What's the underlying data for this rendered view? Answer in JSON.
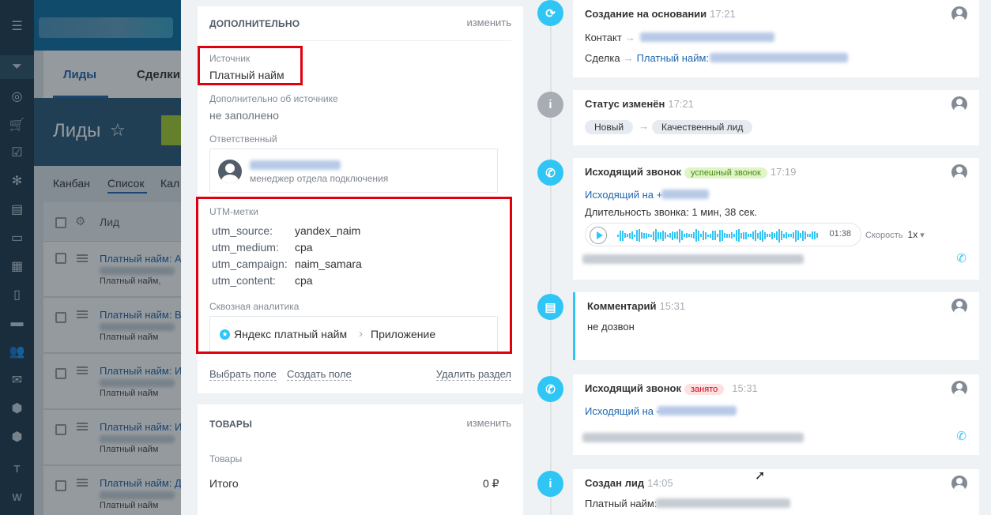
{
  "nav": {
    "letters": [
      "T",
      "W"
    ]
  },
  "background": {
    "tabs": [
      "Лиды",
      "Сделки"
    ],
    "page_title": "Лиды",
    "views": [
      "Канбан",
      "Список",
      "Кал"
    ],
    "column_header": "Лид",
    "rows": [
      {
        "title": "Платный найм: А",
        "sub": "Платный найм,"
      },
      {
        "title": "Платный найм: В",
        "sub": "Платный найм"
      },
      {
        "title": "Платный найм: И",
        "sub": "Платный найм"
      },
      {
        "title": "Платный найм: И",
        "sub": "Платный найм"
      },
      {
        "title": "Платный найм: Д",
        "sub": "Платный найм"
      }
    ]
  },
  "extra_section": {
    "title": "ДОПОЛНИТЕЛЬНО",
    "edit": "изменить",
    "source_label": "Источник",
    "source_value": "Платный найм",
    "source_more_label": "Дополнительно об источнике",
    "source_more_value": "не заполнено",
    "responsible_label": "Ответственный",
    "responsible_role": "менеджер отдела подключения",
    "utm_label": "UTM-метки",
    "utm": [
      {
        "key": "utm_source:",
        "value": "yandex_naim"
      },
      {
        "key": "utm_medium:",
        "value": "cpa"
      },
      {
        "key": "utm_campaign:",
        "value": "naim_samara"
      },
      {
        "key": "utm_content:",
        "value": "cpa"
      }
    ],
    "analytics_label": "Сквозная аналитика",
    "analytics_source": "Яндекс платный найм",
    "analytics_sep": "›",
    "analytics_target": "Приложение",
    "link_choose": "Выбрать поле",
    "link_create": "Создать поле",
    "link_delete": "Удалить раздел"
  },
  "goods_section": {
    "title": "ТОВАРЫ",
    "edit": "изменить",
    "goods_label": "Товары",
    "total_label": "Итого",
    "total_value": "0 ₽"
  },
  "timeline": [
    {
      "title": "Создание на основании",
      "time": "17:21",
      "contact_label": "Контакт",
      "deal_label": "Сделка",
      "deal_link": "Платный найм:"
    },
    {
      "title": "Статус изменён",
      "time": "17:21",
      "from": "Новый",
      "to": "Качественный лид"
    },
    {
      "title": "Исходящий звонок",
      "badge": "успешный звонок",
      "time": "17:19",
      "line1": "Исходящий на +",
      "line2": "Длительность звонка: 1 мин, 38 сек.",
      "duration": "01:38",
      "speed_label": "Скорость",
      "speed_value": "1x"
    },
    {
      "title": "Комментарий",
      "time": "15:31",
      "text": "не дозвон"
    },
    {
      "title": "Исходящий звонок",
      "badge": "занято",
      "time": "15:31",
      "line1": "Исходящий на -"
    },
    {
      "title": "Создан лид",
      "time": "14:05",
      "line1": "Платный найм:"
    }
  ],
  "colors": {
    "accent": "#2fc6f6",
    "link": "#2067b0",
    "highlight_red": "#e1000f",
    "nav_bg": "#1f3a4d"
  },
  "icons": [
    "menu-icon",
    "filter-icon",
    "target-icon",
    "cart-icon",
    "task-icon",
    "play-icon",
    "phone-icon",
    "comment-icon",
    "info-icon",
    "refresh-icon"
  ]
}
